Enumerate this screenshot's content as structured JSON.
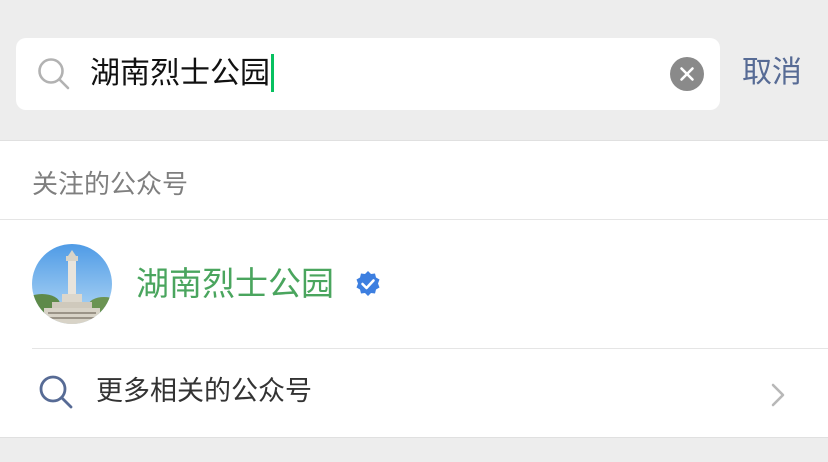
{
  "search": {
    "query": "湖南烈士公园",
    "cancel_label": "取消"
  },
  "section": {
    "header": "关注的公众号"
  },
  "account": {
    "name": "湖南烈士公园",
    "verified": true
  },
  "more": {
    "label": "更多相关的公众号"
  },
  "colors": {
    "accent_green": "#07c160",
    "account_name": "#4aa55e",
    "link_blue": "#576b95",
    "verified_blue": "#3d7fe0",
    "background": "#ededed"
  },
  "icons": {
    "search": "search-icon",
    "clear": "clear-icon",
    "verified": "verified-icon",
    "chevron": "chevron-right-icon"
  }
}
